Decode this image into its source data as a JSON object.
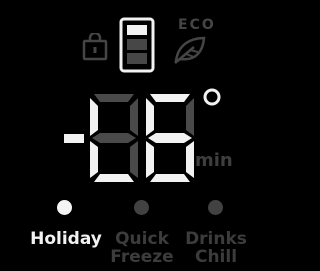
{
  "status_icons": {
    "lock": {
      "icon": "padlock-icon",
      "state": "off"
    },
    "fridge": {
      "icon": "fridge-icon",
      "state": "on"
    },
    "eco": {
      "icon": "leaf-icon",
      "label": "ECO",
      "state": "off"
    }
  },
  "display": {
    "value": "-88",
    "lit_segments": "-",
    "unit": "min",
    "degree": "°"
  },
  "modes": [
    {
      "label": "Holiday",
      "active": true
    },
    {
      "label": "Quick Freeze",
      "lines": [
        "Quick",
        "Freeze"
      ],
      "active": false
    },
    {
      "label": "Drinks Chill",
      "lines": [
        "Drinks",
        "Chill"
      ],
      "active": false
    }
  ],
  "colors": {
    "background": "#000000",
    "active": "#f2f2f2",
    "inactive": "#3c3c3c"
  }
}
